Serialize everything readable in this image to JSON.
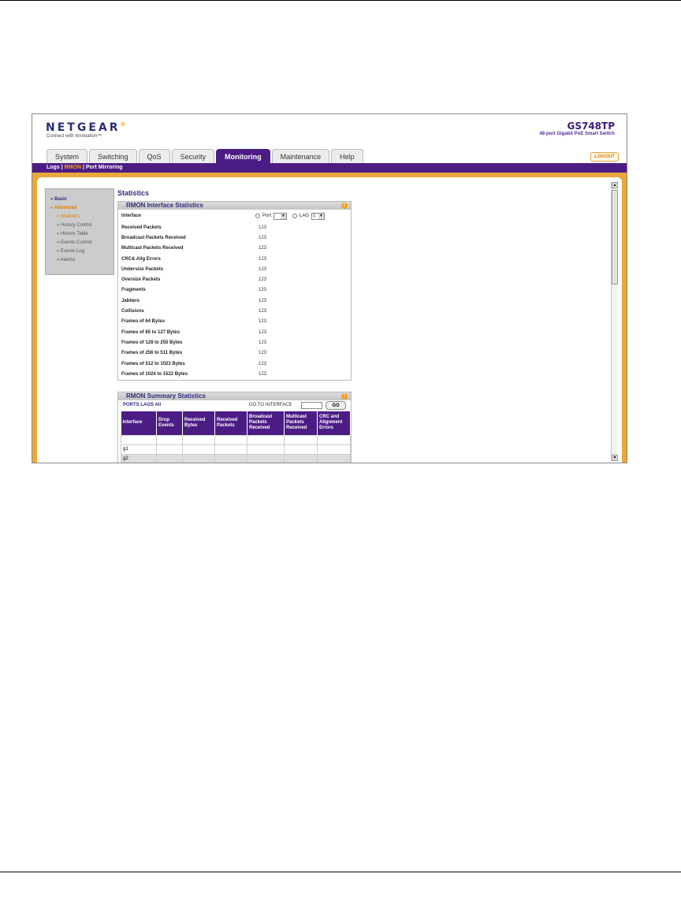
{
  "brand": {
    "logo": "NETGEAR",
    "trademark": "®",
    "tagline": "Connect with Innovation™"
  },
  "model": {
    "name": "GS748TP",
    "description": "48-port Gigabit PoE Smart Switch"
  },
  "tabs": [
    {
      "label": "System"
    },
    {
      "label": "Switching"
    },
    {
      "label": "QoS"
    },
    {
      "label": "Security"
    },
    {
      "label": "Monitoring"
    },
    {
      "label": "Maintenance"
    },
    {
      "label": "Help"
    }
  ],
  "logout_label": "LOGOUT",
  "subnav": {
    "logs": "Logs",
    "sep1": "|",
    "rmon": "RMON",
    "sep2": "|",
    "port_mirroring": "Port Mirroring"
  },
  "leftnav": {
    "basic": "» Basic",
    "advanced": "» Advanced",
    "items": [
      {
        "label": "» Statistics"
      },
      {
        "label": "» History Control"
      },
      {
        "label": "» History Table"
      },
      {
        "label": "» Events Control"
      },
      {
        "label": "» Events Log"
      },
      {
        "label": "» Alarms"
      }
    ]
  },
  "page_title": "Statistics",
  "interface_panel": {
    "title": "RMON Interface Statistics",
    "info_icon": "!",
    "interface_label": "Interface",
    "port_label": "Port",
    "port_value": "",
    "lag_label": "LAG",
    "lag_value": "1",
    "rows": [
      {
        "label": "Received Packets",
        "value": "123"
      },
      {
        "label": "Broadcast Packets Received",
        "value": "123"
      },
      {
        "label": "Multicast Packets Received",
        "value": "123"
      },
      {
        "label": "CRC& Alig Errors",
        "value": "123"
      },
      {
        "label": "Undersize Packets",
        "value": "123"
      },
      {
        "label": "Oversize Packets",
        "value": "123"
      },
      {
        "label": "Fragments",
        "value": "123"
      },
      {
        "label": "Jabbers",
        "value": "123"
      },
      {
        "label": "Collisions",
        "value": "123"
      },
      {
        "label": "Frames of 64 Bytes",
        "value": "123"
      },
      {
        "label": "Frames of 65 to 127 Bytes",
        "value": "123"
      },
      {
        "label": "Frames of 128 to 255 Bytes",
        "value": "123"
      },
      {
        "label": "Frames of 256 to 511 Bytes",
        "value": "123"
      },
      {
        "label": "Frames of 512 to 1023 Bytes",
        "value": "123"
      },
      {
        "label": "Frames of 1024 to 1522 Bytes",
        "value": "123"
      }
    ]
  },
  "summary_panel": {
    "title": "RMON Summary Statistics",
    "info_icon": "!",
    "ports_lags_all": "PORTS LAGS All",
    "goto_label": "GO TO INTERFACE",
    "go_button": "GO",
    "columns": [
      "Interface",
      "Drop Events",
      "Received Bytes",
      "Received Packets",
      "Broadcast Packets Received",
      "Multicast Packets Received",
      "CRC and Alignment Errors"
    ],
    "rows": [
      {
        "interface": ""
      },
      {
        "interface": "g1"
      },
      {
        "interface": "g2"
      }
    ]
  },
  "scrollbar": {
    "up": "▲",
    "down": "▼"
  }
}
